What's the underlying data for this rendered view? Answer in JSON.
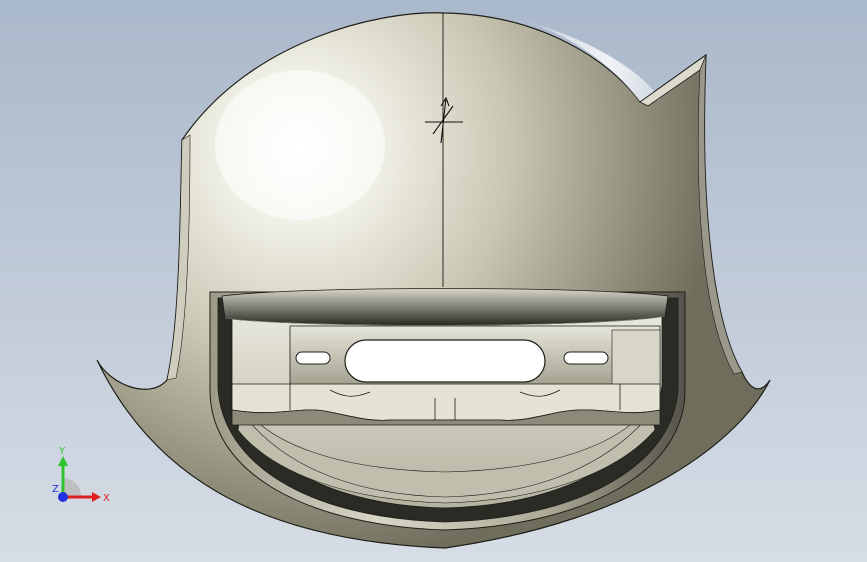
{
  "viewport": {
    "background_top": "#aab8cb",
    "background_bottom": "#d6dde6"
  },
  "model": {
    "part_shade_light": "#f4f3ea",
    "part_shade_mid": "#b9b7a3",
    "part_shade_dark": "#5e5c4c",
    "edge_color": "#1e1e18",
    "origin_icon": "sketch-origin-icon"
  },
  "triad": {
    "x_label": "X",
    "y_label": "Y",
    "z_label": "Z",
    "x_color": "#e02020",
    "y_color": "#2ec42e",
    "z_color": "#2233dd"
  }
}
